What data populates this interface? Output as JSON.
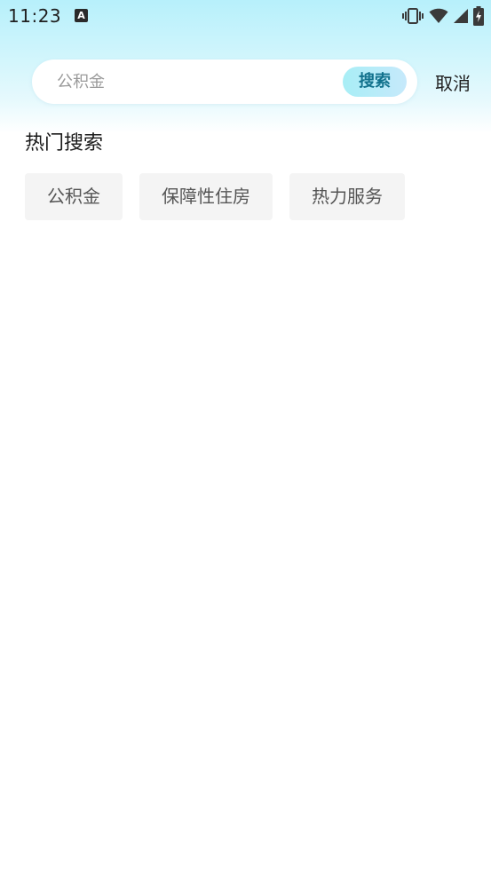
{
  "status_bar": {
    "time": "11:23",
    "notification_icon_letter": "A",
    "icons": [
      "vibrate-icon",
      "wifi-icon",
      "cell-signal-icon",
      "battery-charging-icon"
    ]
  },
  "search": {
    "placeholder": "公积金",
    "value": "",
    "button_label": "搜索",
    "cancel_label": "取消"
  },
  "hot_search": {
    "title": "热门搜索",
    "items": [
      {
        "label": "公积金"
      },
      {
        "label": "保障性住房"
      },
      {
        "label": "热力服务"
      }
    ]
  },
  "colors": {
    "header_gradient_top": "#b7f0fb",
    "search_button_text": "#12728d",
    "chip_background": "#f4f4f4"
  }
}
